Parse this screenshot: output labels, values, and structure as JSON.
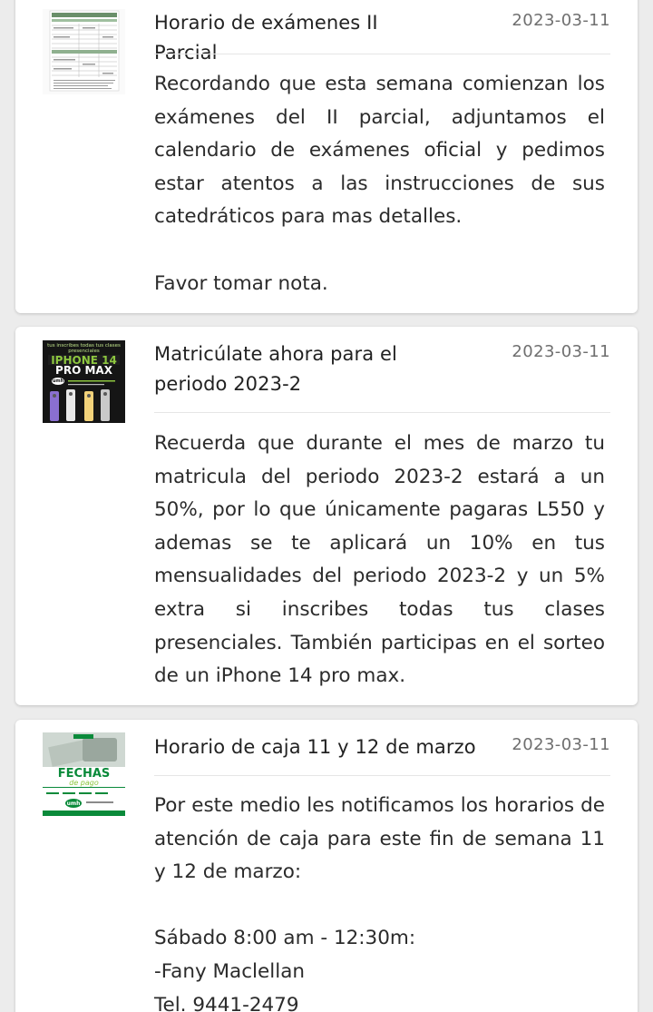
{
  "posts": [
    {
      "title": "Horario de exámenes II Parcial",
      "date": "2023-03-11",
      "body": "Recordando que esta semana comienzan los exámenes del II parcial, adjuntamos el calendario de exámenes oficial y pedimos estar atentos a las instrucciones de sus catedráticos para mas detalles.\n\nFavor tomar nota.",
      "thumbnail": "exam-schedule-table-icon"
    },
    {
      "title": "Matricúlate ahora para el periodo 2023-2",
      "date": "2023-03-11",
      "body": "Recuerda que durante el mes de marzo tu matricula del periodo 2023-2 estará a un 50%, por lo que únicamente pagaras L550 y ademas se te aplicará un 10% en tus mensualidades del periodo 2023-2 y un 5% extra si inscribes todas tus clases presenciales. También participas en el sorteo de un iPhone 14 pro max.",
      "thumbnail": "iphone-promo-icon",
      "thumbnail_text": {
        "top": "tus inscribes todas tus clases presenciales",
        "headline": "IPHONE 14",
        "subheadline": "PRO MAX",
        "brand": "umh"
      }
    },
    {
      "title": "Horario de caja 11 y 12 de marzo",
      "date": "2023-03-11",
      "body": "Por este medio les notificamos los horarios de atención de caja para este fin de semana 11 y 12 de marzo:\n\nSábado 8:00 am - 12:30m:\n-Fany Maclellan\n Tel. 9441-2479",
      "thumbnail": "payment-dates-icon",
      "thumbnail_text": {
        "headline": "FECHAS",
        "script": "de pago",
        "brand": "umh"
      }
    }
  ],
  "colors": {
    "background": "#ececec",
    "card": "#ffffff",
    "date": "#6f6f6f",
    "promo_dark": "#151515",
    "promo_green": "#8dc63f",
    "payment_green": "#0a8a3a"
  }
}
